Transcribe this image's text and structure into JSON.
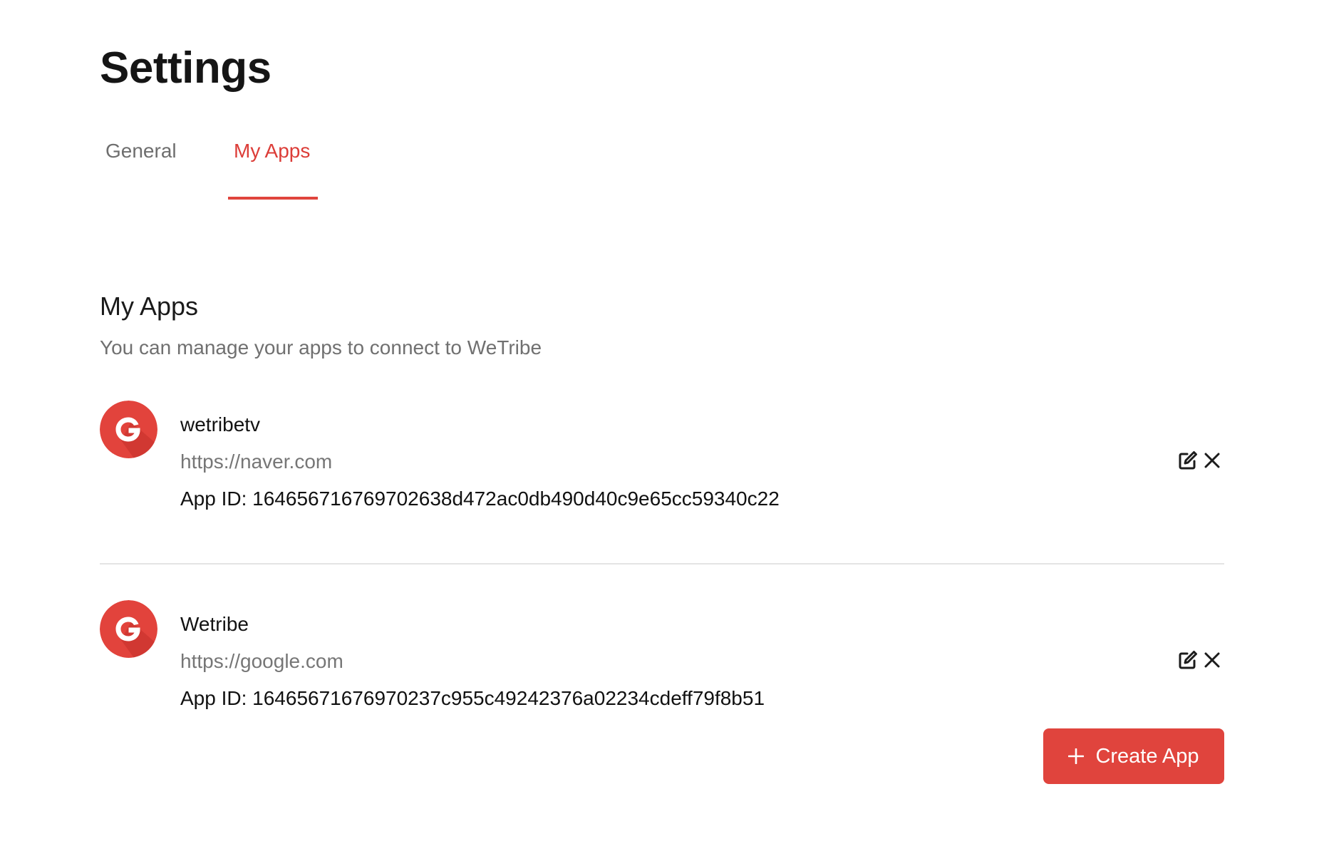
{
  "header": {
    "title": "Settings"
  },
  "tabs": [
    {
      "label": "General",
      "active": false
    },
    {
      "label": "My Apps",
      "active": true
    }
  ],
  "section": {
    "title": "My Apps",
    "description": "You can manage your apps to connect to WeTribe"
  },
  "apps": [
    {
      "avatar_icon": "g-logo-icon",
      "name": "wetribetv",
      "url": "https://naver.com",
      "app_id": "App ID: 164656716769702638d472ac0db490d40c9e65cc59340c22"
    },
    {
      "avatar_icon": "g-logo-icon",
      "name": "Wetribe",
      "url": "https://google.com",
      "app_id": "App ID: 16465671676970237c955c49242376a02234cdeff79f8b51"
    }
  ],
  "actions": {
    "create_label": "Create App",
    "create_icon": "plus-icon",
    "edit_icon": "edit-icon",
    "delete_icon": "close-icon"
  },
  "colors": {
    "accent": "#e0443d",
    "accent_text": "#dc3d38",
    "muted_text": "#707070",
    "divider": "#e4e4e4"
  }
}
